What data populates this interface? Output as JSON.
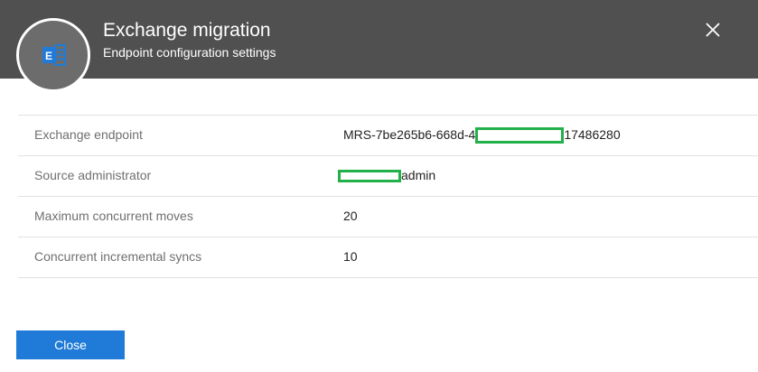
{
  "header": {
    "title": "Exchange migration",
    "subtitle": "Endpoint configuration settings",
    "icon": "exchange-logo-icon",
    "close_icon": "close-icon",
    "colors": {
      "background": "#505050",
      "text": "#ffffff"
    }
  },
  "properties": [
    {
      "label": "Exchange endpoint",
      "value_prefix": "MRS-7be265b6-668d-4",
      "value_suffix": "17486280"
    },
    {
      "label": "Source administrator",
      "value_prefix": "",
      "value_suffix": "admin"
    },
    {
      "label": "Maximum concurrent moves",
      "value_prefix": "20",
      "value_suffix": ""
    },
    {
      "label": "Concurrent incremental syncs",
      "value_prefix": "10",
      "value_suffix": ""
    }
  ],
  "footer": {
    "close_label": "Close",
    "accent_color": "#1f7bd7"
  },
  "redaction_color": "#22b04b"
}
